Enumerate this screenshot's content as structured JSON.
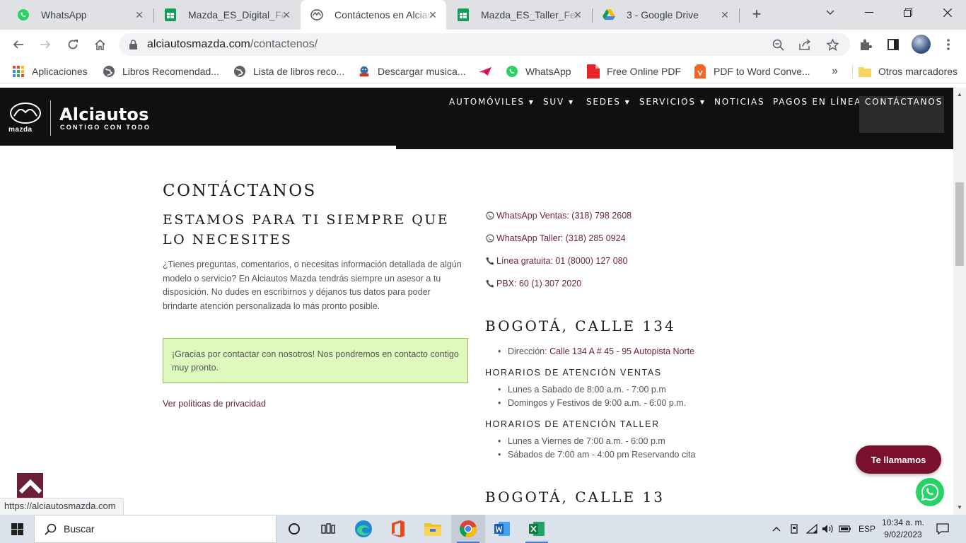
{
  "browser": {
    "tabs": [
      {
        "title": "WhatsApp",
        "icon": "whatsapp-icon",
        "active": false
      },
      {
        "title": "Mazda_ES_Digital_Fe",
        "icon": "sheets-icon",
        "active": false
      },
      {
        "title": "Contáctenos en Alciautos",
        "icon": "mazda-icon",
        "active": true
      },
      {
        "title": "Mazda_ES_Taller_Feb",
        "icon": "sheets-icon",
        "active": false
      },
      {
        "title": "3 - Google Drive",
        "icon": "drive-icon",
        "active": false
      }
    ],
    "url_domain": "alciautosmazda.com",
    "url_path": "/contactenos/",
    "bookmarks": [
      {
        "label": "Aplicaciones",
        "icon": "apps-grid-icon"
      },
      {
        "label": "Libros Recomendad...",
        "icon": "globe-icon"
      },
      {
        "label": "Lista de libros reco...",
        "icon": "globe-icon"
      },
      {
        "label": "Descargar musica...",
        "icon": "music-site-icon"
      },
      {
        "label": "",
        "icon": "paper-plane-icon"
      },
      {
        "label": "WhatsApp",
        "icon": "whatsapp-icon"
      },
      {
        "label": "Free Online PDF",
        "icon": "pdf-icon"
      },
      {
        "label": "PDF to Word Conve...",
        "icon": "pdf-convert-icon"
      }
    ],
    "more_bookmarks": "»",
    "other_bookmarks": "Otros marcadores",
    "status_url": "https://alciautosmazda.com"
  },
  "site": {
    "brand": "Alciautos",
    "tagline": "CONTIGO CON TODO",
    "logo_word": "mazda",
    "menu": [
      {
        "label": "AUTOMÓVILES",
        "dropdown": true
      },
      {
        "label": "SUV",
        "dropdown": true
      },
      {
        "label": "SEDES",
        "dropdown": true
      },
      {
        "label": "SERVICIOS",
        "dropdown": true
      },
      {
        "label": "NOTICIAS",
        "dropdown": false
      },
      {
        "label": "PAGOS EN LÍNEA",
        "dropdown": false
      },
      {
        "label": "CONTÁCTANOS",
        "dropdown": false
      }
    ],
    "accent_color": "#6b1f36"
  },
  "content": {
    "title": "CONTÁCTANOS",
    "subtitle": "ESTAMOS PARA TI SIEMPRE QUE LO NECESITES",
    "intro": "¿Tienes preguntas, comentarios, o necesitas información detallada de algún modelo o servicio? En Alciautos Mazda tendrás siempre un asesor a tu disposición. No dudes en escribirnos y déjanos tus datos para poder brindarte atención personalizada lo más pronto posible.",
    "success_message": "¡Gracias por contactar con nosotros! Nos pondremos en contacto contigo muy pronto.",
    "privacy_link": "Ver políticas de privacidad",
    "contacts": [
      {
        "label": "WhatsApp Ventas: (318) 798 2608",
        "icon": "whatsapp-icon"
      },
      {
        "label": "WhatsApp Taller: (318) 285 0924",
        "icon": "whatsapp-icon"
      },
      {
        "label": "Línea gratuita: 01 (8000) 127 080",
        "icon": "phone-icon"
      },
      {
        "label": "PBX: 60 (1) 307 2020",
        "icon": "phone-icon"
      }
    ],
    "locations": [
      {
        "name": "BOGOTÁ, CALLE 134",
        "address_label": "Dirección:",
        "address": "Calle 134 A # 45 - 95 Autopista Norte",
        "sales_title": "HORARIOS DE ATENCIÓN VENTAS",
        "sales_hours": [
          "Lunes a Sabado de 8:00 a.m. - 7:00 p.m",
          "Domingos y Festivos de 9:00 a.m. - 6:00 p.m."
        ],
        "workshop_title": "HORARIOS DE ATENCIÓN TALLER",
        "workshop_hours": [
          "Lunes a Viernes de 7:00 a.m. - 6:00 p.m",
          "Sábados de 7:00 am - 4:00 pm Reservando cita"
        ]
      },
      {
        "name": "BOGOTÁ, CALLE 13"
      }
    ],
    "call_button": "Te llamamos"
  },
  "taskbar": {
    "search_placeholder": "Buscar",
    "language": "ESP",
    "time": "10:34 a. m.",
    "date": "9/02/2023"
  }
}
